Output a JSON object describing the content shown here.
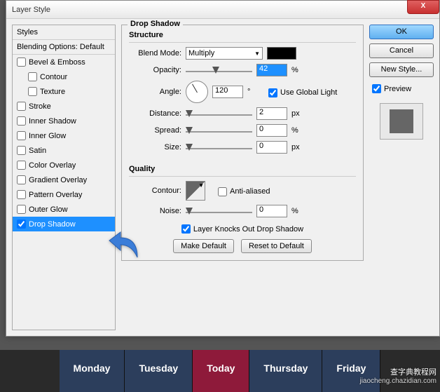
{
  "bg": {
    "tabs": [
      "Monday",
      "Tuesday",
      "Today",
      "Thursday",
      "Friday"
    ],
    "active_tab": 2
  },
  "watermark": {
    "main": "查字典教程网",
    "sub": "jiaocheng.chazidian.com"
  },
  "dialog": {
    "title": "Layer Style",
    "close": "X",
    "buttons": {
      "ok": "OK",
      "cancel": "Cancel",
      "new_style": "New Style...",
      "preview": "Preview"
    },
    "styles_header": "Styles",
    "blending_options": "Blending Options: Default",
    "style_items": [
      {
        "label": "Bevel & Emboss",
        "checked": false,
        "indent": false
      },
      {
        "label": "Contour",
        "checked": false,
        "indent": true
      },
      {
        "label": "Texture",
        "checked": false,
        "indent": true
      },
      {
        "label": "Stroke",
        "checked": false,
        "indent": false
      },
      {
        "label": "Inner Shadow",
        "checked": false,
        "indent": false
      },
      {
        "label": "Inner Glow",
        "checked": false,
        "indent": false
      },
      {
        "label": "Satin",
        "checked": false,
        "indent": false
      },
      {
        "label": "Color Overlay",
        "checked": false,
        "indent": false
      },
      {
        "label": "Gradient Overlay",
        "checked": false,
        "indent": false
      },
      {
        "label": "Pattern Overlay",
        "checked": false,
        "indent": false
      },
      {
        "label": "Outer Glow",
        "checked": false,
        "indent": false
      },
      {
        "label": "Drop Shadow",
        "checked": true,
        "indent": false,
        "selected": true
      }
    ],
    "drop_shadow": {
      "title": "Drop Shadow",
      "structure": "Structure",
      "blend_mode_lbl": "Blend Mode:",
      "blend_mode": "Multiply",
      "opacity_lbl": "Opacity:",
      "opacity": "42",
      "opacity_unit": "%",
      "angle_lbl": "Angle:",
      "angle": "120",
      "angle_unit": "°",
      "global_light": "Use Global Light",
      "distance_lbl": "Distance:",
      "distance": "2",
      "distance_unit": "px",
      "spread_lbl": "Spread:",
      "spread": "0",
      "spread_unit": "%",
      "size_lbl": "Size:",
      "size": "0",
      "size_unit": "px",
      "quality": "Quality",
      "contour_lbl": "Contour:",
      "anti_aliased": "Anti-aliased",
      "noise_lbl": "Noise:",
      "noise": "0",
      "noise_unit": "%",
      "knocks_out": "Layer Knocks Out Drop Shadow",
      "make_default": "Make Default",
      "reset_default": "Reset to Default"
    }
  }
}
